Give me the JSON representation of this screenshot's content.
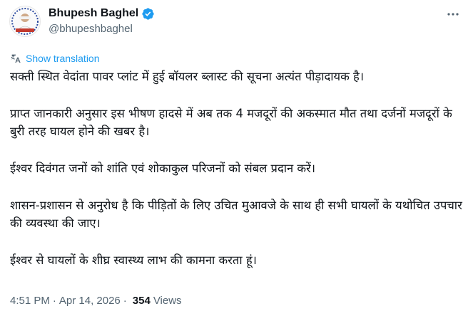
{
  "author": {
    "display_name": "Bhupesh Baghel",
    "handle": "@bhupeshbaghel",
    "verified": true,
    "verified_color": "#1d9bf0"
  },
  "translate": {
    "label": "Show translation",
    "icon": "translate-icon",
    "color": "#1d9bf0"
  },
  "tweet": {
    "paragraphs": [
      "सक्ती स्थित वेदांता पावर प्लांट में हुई बॉयलर ब्लास्ट की सूचना अत्यंत पीड़ादायक है।",
      "प्राप्त जानकारी अनुसार इस भीषण हादसे में अब तक 4 मजदूरों की अकस्मात मौत तथा दर्जनों मजदूरों के बुरी तरह घायल होने की खबर है।",
      "ईश्वर दिवंगत जनों को शांति एवं शोकाकुल परिजनों को संबल प्रदान करें।",
      "शासन-प्रशासन से अनुरोध है कि पीड़ितों के लिए उचित मुआवजे के साथ ही सभी घायलों के यथोचित उपचार की व्यवस्था की जाए।",
      "ईश्वर से घायलों के शीघ्र स्वास्थ्य लाभ की कामना करता हूं।"
    ]
  },
  "meta": {
    "time": "4:51 PM",
    "separator": "·",
    "date": "Apr 14, 2026",
    "views_count": "354",
    "views_label": "Views"
  }
}
